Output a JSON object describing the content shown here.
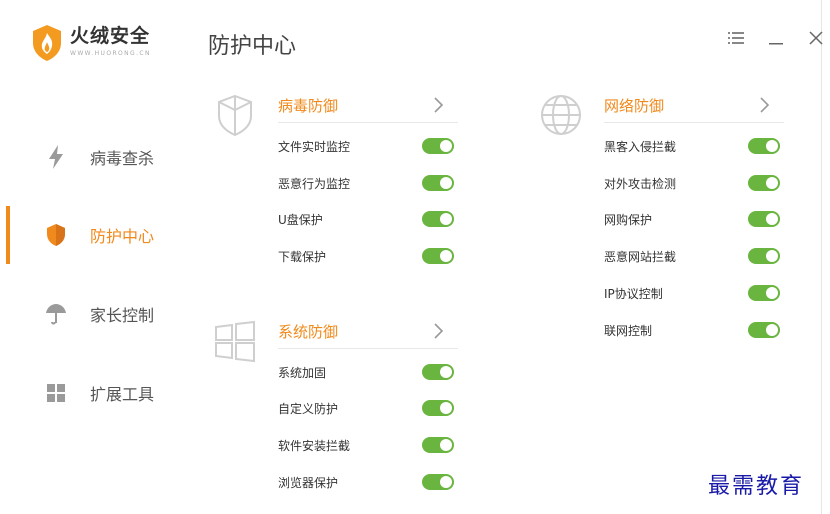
{
  "app": {
    "name": "火绒安全",
    "subtitle": "WWW.HUORONG.CN",
    "accent_color": "#f08a1c",
    "toggle_color": "#69b53f"
  },
  "header": {
    "title": "防护中心",
    "menu_icon": "menu-icon",
    "minimize_icon": "minimize-icon",
    "close_icon": "close-icon"
  },
  "sidebar": {
    "items": [
      {
        "label": "病毒查杀",
        "icon": "lightning-icon",
        "active": false
      },
      {
        "label": "防护中心",
        "icon": "shield-icon",
        "active": true
      },
      {
        "label": "家长控制",
        "icon": "umbrella-icon",
        "active": false
      },
      {
        "label": "扩展工具",
        "icon": "grid-icon",
        "active": false
      }
    ]
  },
  "sections": {
    "virus": {
      "title": "病毒防御",
      "icon": "shield-outline-icon",
      "items": [
        {
          "label": "文件实时监控",
          "on": true
        },
        {
          "label": "恶意行为监控",
          "on": true
        },
        {
          "label": "U盘保护",
          "on": true
        },
        {
          "label": "下载保护",
          "on": true
        }
      ]
    },
    "system": {
      "title": "系统防御",
      "icon": "windows-icon",
      "items": [
        {
          "label": "系统加固",
          "on": true
        },
        {
          "label": "自定义防护",
          "on": true
        },
        {
          "label": "软件安装拦截",
          "on": true
        },
        {
          "label": "浏览器保护",
          "on": true
        }
      ]
    },
    "network": {
      "title": "网络防御",
      "icon": "globe-icon",
      "items": [
        {
          "label": "黑客入侵拦截",
          "on": true
        },
        {
          "label": "对外攻击检测",
          "on": true
        },
        {
          "label": "网购保护",
          "on": true
        },
        {
          "label": "恶意网站拦截",
          "on": true
        },
        {
          "label": "IP协议控制",
          "on": true
        },
        {
          "label": "联网控制",
          "on": true
        }
      ]
    }
  },
  "watermark": "最需教育"
}
